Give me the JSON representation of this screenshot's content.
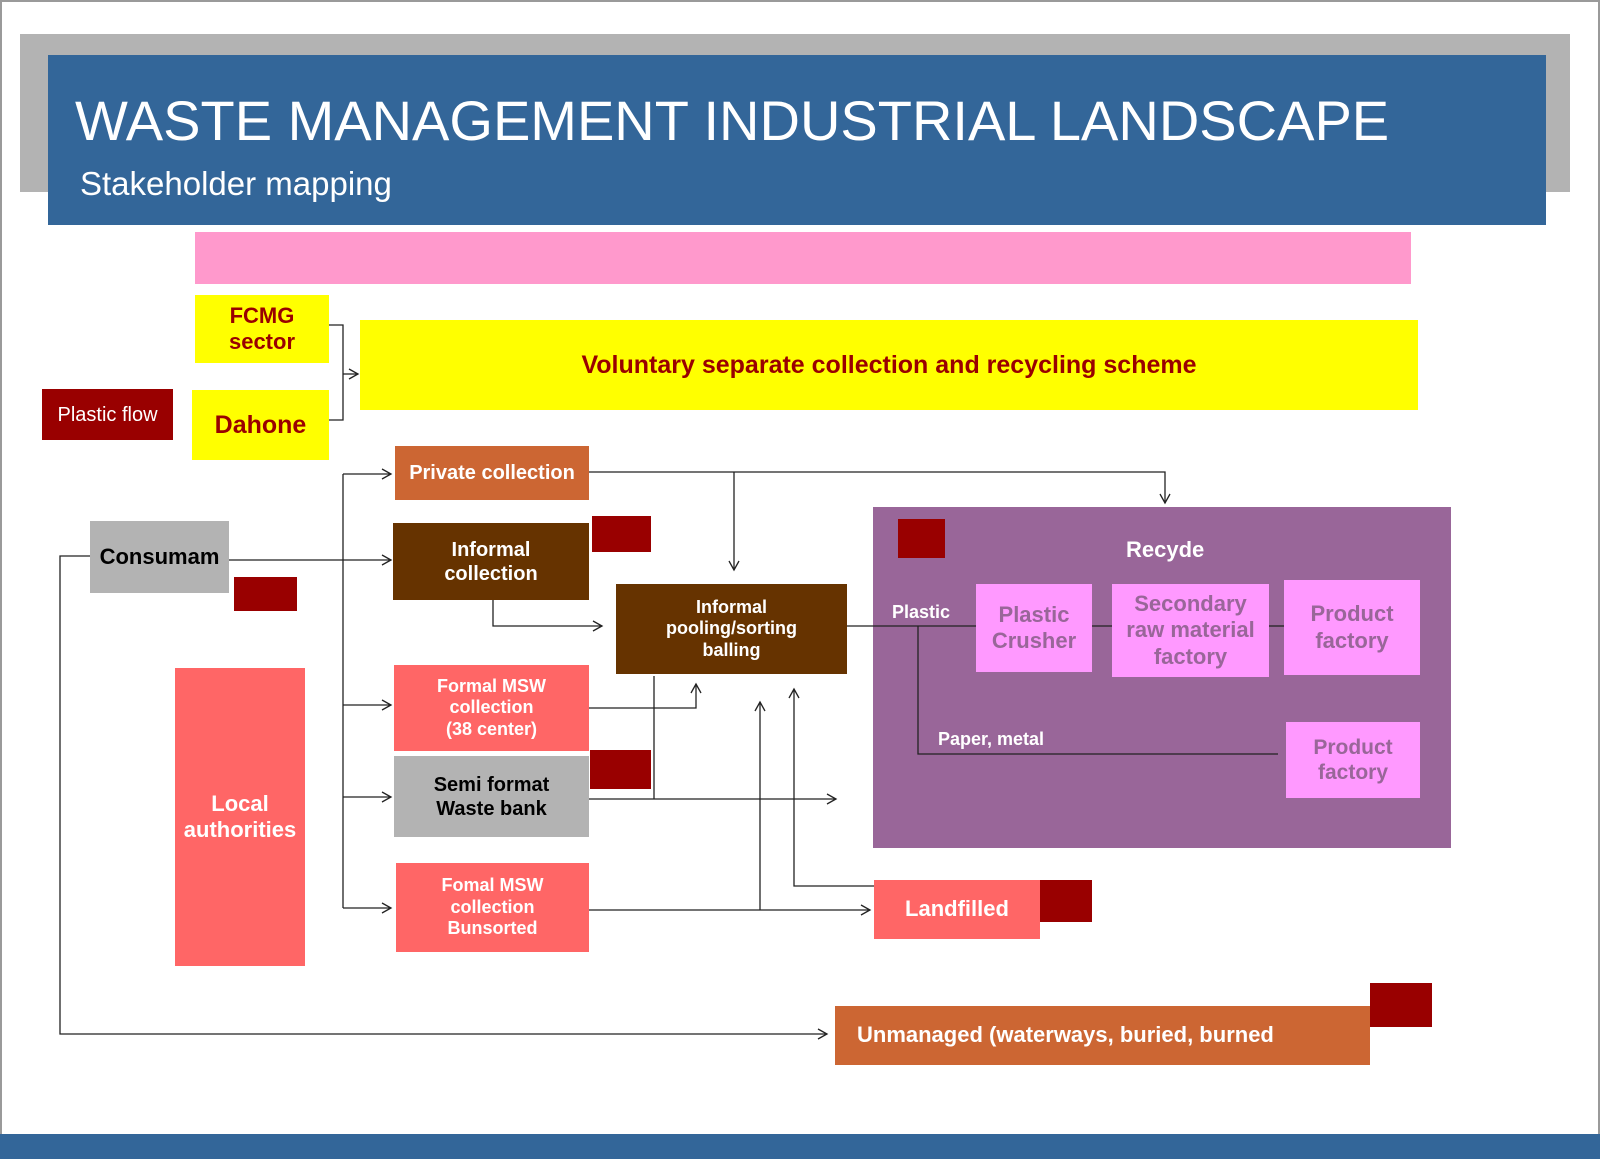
{
  "header": {
    "title": "WASTE MANAGEMENT INDUSTRIAL LANDSCAPE",
    "subtitle": "Stakeholder mapping"
  },
  "colors": {
    "header_blue": "#336699",
    "header_shadow": "#b3b3b3",
    "pink_banner": "#ff99cc",
    "yellow": "#ffff00",
    "dark_red": "#990000",
    "orange": "#cc6633",
    "brown": "#663300",
    "salmon": "#ff6666",
    "gray": "#b3b3b3",
    "purple": "#996699",
    "light_pink": "#ff99ff"
  },
  "legend": {
    "plastic_flow": "Plastic flow"
  },
  "nodes": {
    "fcmg": "FCMG\nsector",
    "dahone": "Dahone",
    "voluntary": "Voluntary separate collection and recycling scheme",
    "private_collection": "Private collection",
    "consumam": "Consumam",
    "informal_collection": "Informal\ncollection",
    "informal_pooling": "Informal\npooling/sorting\nballing",
    "local_authorities": "Local\nauthorities",
    "formal_msw": "Formal MSW\ncollection\n(38 center)",
    "semi_format": "Semi format\nWaste bank",
    "fomal_msw_unsorted": "Fomal MSW\ncollection\nBunsorted",
    "landfilled": "Landfilled",
    "unmanaged": "Unmanaged (waterways, buried, burned",
    "recycle_title": "Recyde",
    "plastic_label": "Plastic",
    "plastic_crusher": "Plastic\nCrusher",
    "secondary_raw": "Secondary\nraw material\nfactory",
    "product_factory_1": "Product\nfactory",
    "paper_metal_label": "Paper, metal",
    "product_factory_2": "Product\nfactory"
  }
}
